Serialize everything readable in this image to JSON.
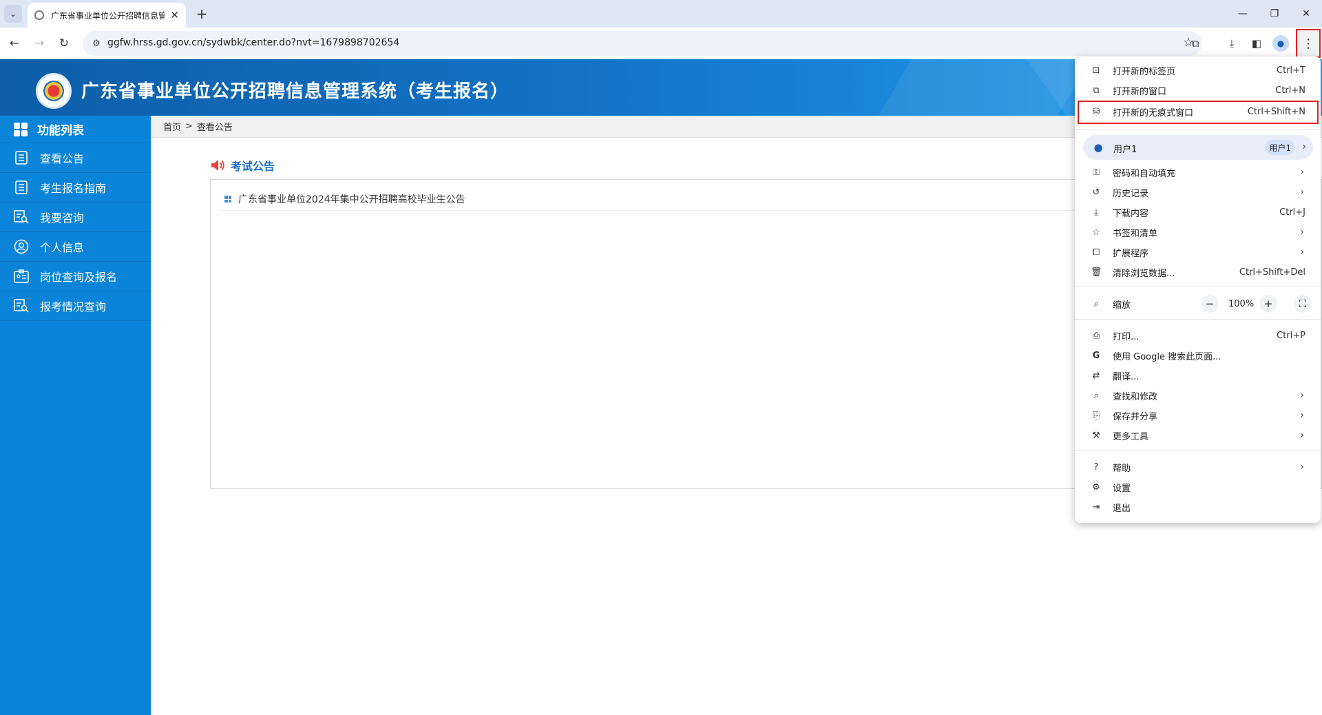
{
  "browser": {
    "tab_title": "广东省事业单位公开招聘信息管理",
    "url": "ggfw.hrss.gd.gov.cn/sydwbk/center.do?nvt=1679898702654",
    "new_tab_symbol": "+",
    "close_symbol": "✕"
  },
  "header": {
    "title": "广东省事业单位公开招聘信息管理系统（考生报名）"
  },
  "sidebar": {
    "heading": "功能列表",
    "items": [
      {
        "label": "查看公告",
        "icon": "list-icon"
      },
      {
        "label": "考生报名指南",
        "icon": "guide-icon"
      },
      {
        "label": "我要咨询",
        "icon": "consult-icon"
      },
      {
        "label": "个人信息",
        "icon": "person-icon"
      },
      {
        "label": "岗位查询及报名",
        "icon": "job-icon"
      },
      {
        "label": "报考情况查询",
        "icon": "status-icon"
      }
    ]
  },
  "breadcrumb": {
    "home": "首页",
    "sep": ">",
    "current": "查看公告"
  },
  "content": {
    "section_title": "考试公告",
    "notices": [
      {
        "title": "广东省事业单位2024年集中公开招聘高校毕业生公告"
      }
    ]
  },
  "menu": {
    "items": [
      {
        "label": "打开新的标签页",
        "shortcut": "Ctrl+T",
        "icon": "new-tab-icon"
      },
      {
        "label": "打开新的窗口",
        "shortcut": "Ctrl+N",
        "icon": "new-window-icon"
      },
      {
        "label": "打开新的无痕式窗口",
        "shortcut": "Ctrl+Shift+N",
        "icon": "incognito-icon"
      }
    ],
    "profile": {
      "name": "用户1",
      "chip": "用户1"
    },
    "items2": [
      {
        "label": "密码和自动填充",
        "icon": "key-icon"
      },
      {
        "label": "历史记录",
        "icon": "history-icon"
      },
      {
        "label": "下载内容",
        "shortcut": "Ctrl+J",
        "icon": "download-icon"
      },
      {
        "label": "书签和清单",
        "icon": "bookmark-icon"
      },
      {
        "label": "扩展程序",
        "icon": "extension-icon"
      },
      {
        "label": "清除浏览数据...",
        "shortcut": "Ctrl+Shift+Del",
        "icon": "trash-icon"
      }
    ],
    "zoom": {
      "label": "缩放",
      "value": "100%",
      "minus": "−",
      "plus": "+"
    },
    "items3": [
      {
        "label": "打印...",
        "shortcut": "Ctrl+P",
        "icon": "print-icon"
      },
      {
        "label": "使用 Google 搜索此页面...",
        "icon": "google-icon"
      },
      {
        "label": "翻译...",
        "icon": "translate-icon"
      },
      {
        "label": "查找和修改",
        "icon": "find-icon"
      },
      {
        "label": "保存并分享",
        "icon": "save-share-icon"
      },
      {
        "label": "更多工具",
        "icon": "tools-icon"
      }
    ],
    "items4": [
      {
        "label": "帮助",
        "icon": "help-icon"
      },
      {
        "label": "设置",
        "icon": "settings-icon"
      },
      {
        "label": "退出",
        "icon": "exit-icon"
      }
    ]
  }
}
